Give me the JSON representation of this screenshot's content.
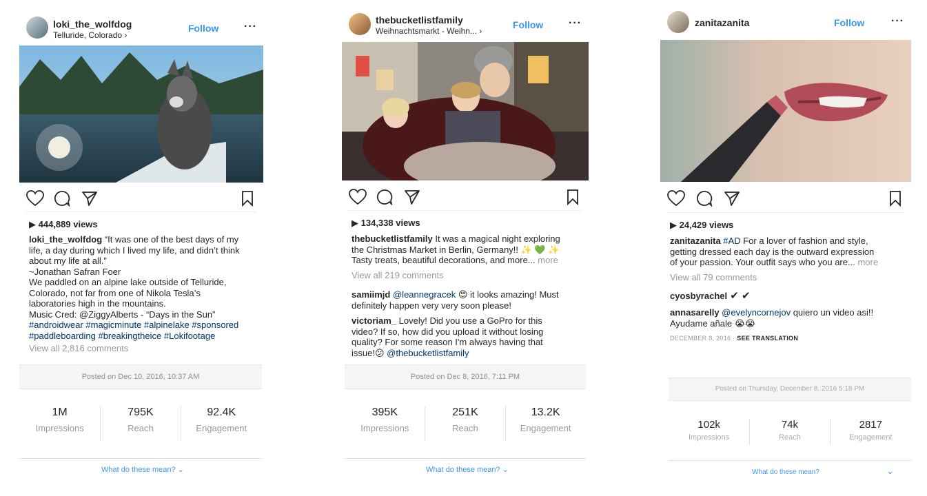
{
  "posts": [
    {
      "username": "loki_the_wolfdog",
      "location": "Telluride, Colorado",
      "follow": "Follow",
      "views": "444,889 views",
      "caption_user": "loki_the_wolfdog",
      "caption_lines": [
        " “It was one of the best days of my",
        "life, a day during which I lived my life, and didn’t think",
        "about my life at all.”",
        "~Jonathan Safran Foer",
        "We paddled on an alpine lake outside of Telluride,",
        "Colorado, not far from one of Nikola Tesla’s",
        "laboratories high in the mountains.",
        "Music Cred: @ZiggyAlberts - “Days in the Sun”"
      ],
      "hashtags": [
        "#androidwear #magicminute #alpinelake #sponsored",
        "#paddleboarding #breakingtheice #Lokifootage"
      ],
      "view_all": "View all 2,816 comments",
      "posted": "Posted on Dec 10, 2016, 10:37 AM",
      "stats": [
        {
          "value": "1M",
          "label": "Impressions"
        },
        {
          "value": "795K",
          "label": "Reach"
        },
        {
          "value": "92.4K",
          "label": "Engagement"
        }
      ],
      "what": "What do these mean?"
    },
    {
      "username": "thebucketlistfamily",
      "location": "Weihnachtsmarkt - Weihn...",
      "follow": "Follow",
      "views": "134,338 views",
      "caption_user": "thebucketlistfamily",
      "caption_lines": [
        " It was a magical night exploring",
        "the Christmas Market in Berlin, Germany!! ✨ 💚 ✨",
        "Tasty treats, beautiful decorations, and more..."
      ],
      "more": "more",
      "view_all": "View all 219 comments",
      "comments": [
        {
          "user": "samiimjd",
          "mention": "@leannegracek",
          "text": " 😍  it looks amazing! Must",
          "text2": "definitely happen very very soon please!"
        },
        {
          "user": "victoriam_",
          "text": " Lovely! Did you use a GoPro for this",
          "lines": [
            "video? If so, how did you upload it without losing",
            "quality? For some reason I'm always having that"
          ],
          "last_text": "issue!😕 ",
          "last_mention": " @thebucketlistfamily"
        }
      ],
      "posted": "Posted on Dec 8, 2016, 7:11 PM",
      "stats": [
        {
          "value": "395K",
          "label": "Impressions"
        },
        {
          "value": "251K",
          "label": "Reach"
        },
        {
          "value": "13.2K",
          "label": "Engagement"
        }
      ],
      "what": "What do these mean?"
    },
    {
      "username": "zanitazanita",
      "follow": "Follow",
      "views": "24,429 views",
      "caption_user": "zanitazanita",
      "caption_tag": " #AD",
      "caption_lines": [
        " For a lover of fashion and style,",
        "getting dressed each day is the outward expression",
        "of your passion. Your outfit says who you are..."
      ],
      "more": "more",
      "view_all": "View all 79 comments",
      "comments": [
        {
          "user": "cyosbyrachel",
          "text": " ✔ ✔"
        },
        {
          "user": "annasarelly",
          "mention": "@evelyncornejov",
          "text": " quiero un video asi!!",
          "text2": "Ayudame añale 😭😭"
        }
      ],
      "date": "DECEMBER 8, 2016",
      "translate": "SEE TRANSLATION",
      "posted": "Posted on Thursday, December 8, 2016 5:18 PM",
      "stats": [
        {
          "value": "102k",
          "label": "Impressions"
        },
        {
          "value": "74k",
          "label": "Reach"
        },
        {
          "value": "2817",
          "label": "Engagement"
        }
      ],
      "what": "What do these mean?"
    }
  ],
  "icons": [
    "heart-icon",
    "comment-icon",
    "share-icon",
    "bookmark-icon",
    "play-icon",
    "chevron-down-icon",
    "more-icon"
  ]
}
